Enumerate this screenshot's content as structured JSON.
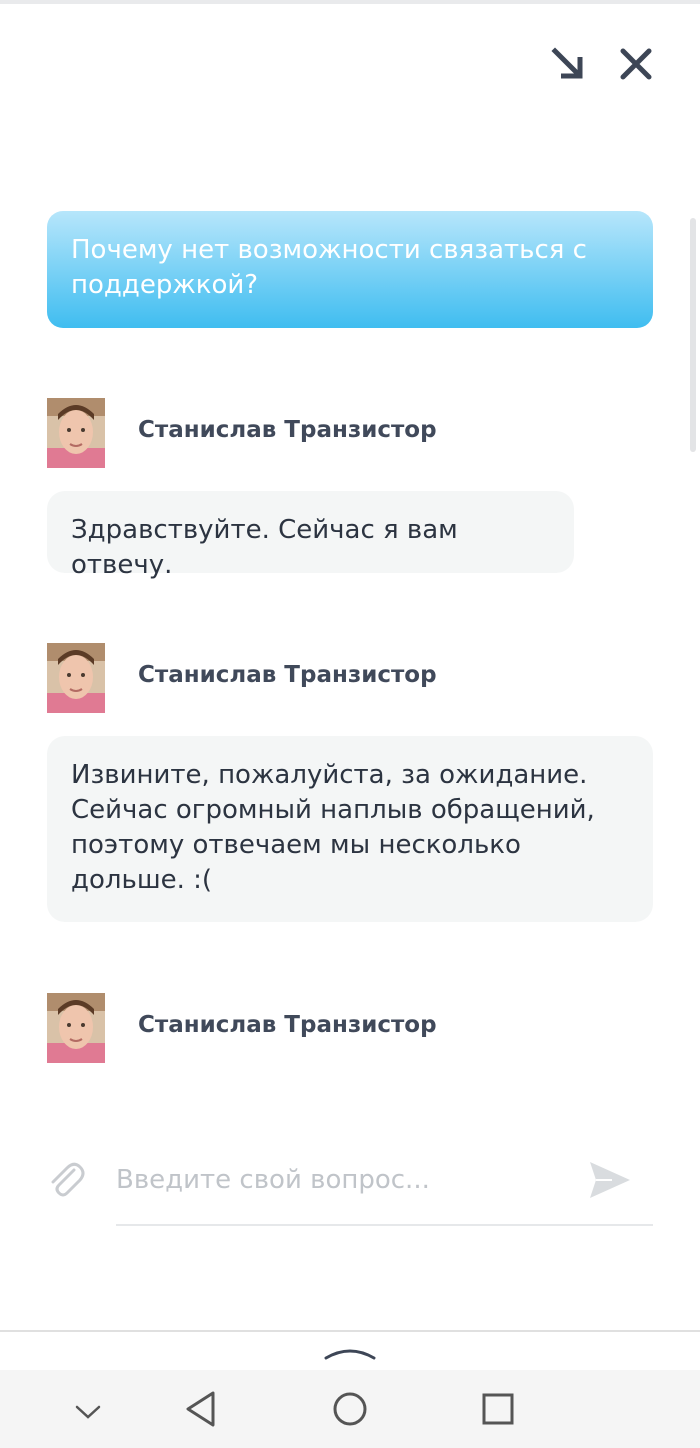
{
  "header": {
    "minimize_icon": "minimize-arrow-icon",
    "close_icon": "close-icon"
  },
  "messages": {
    "user_question": "Почему нет возможности связаться с поддержкой?",
    "agent_name": "Станислав Транзистор",
    "agent_reply_1": "Здравствуйте. Сейчас я вам отвечу.",
    "agent_reply_2": "Извините, пожалуйста, за ожидание. Сейчас огромный наплыв обращений, поэтому отвечаем мы несколько дольше. :("
  },
  "composer": {
    "placeholder": "Введите свой вопрос...",
    "attach_icon": "paperclip-icon",
    "send_icon": "send-icon"
  },
  "navigation": {
    "icons": [
      "chevron-up-icon",
      "chevron-down-icon",
      "back-triangle-icon",
      "home-circle-icon",
      "recents-square-icon"
    ]
  },
  "colors": {
    "user_bubble_top": "#b7e6fb",
    "user_bubble_bottom": "#3fbdf0",
    "agent_bubble": "#f4f6f6",
    "text_dark": "#2c3441",
    "icon_dark": "#3d4656"
  }
}
